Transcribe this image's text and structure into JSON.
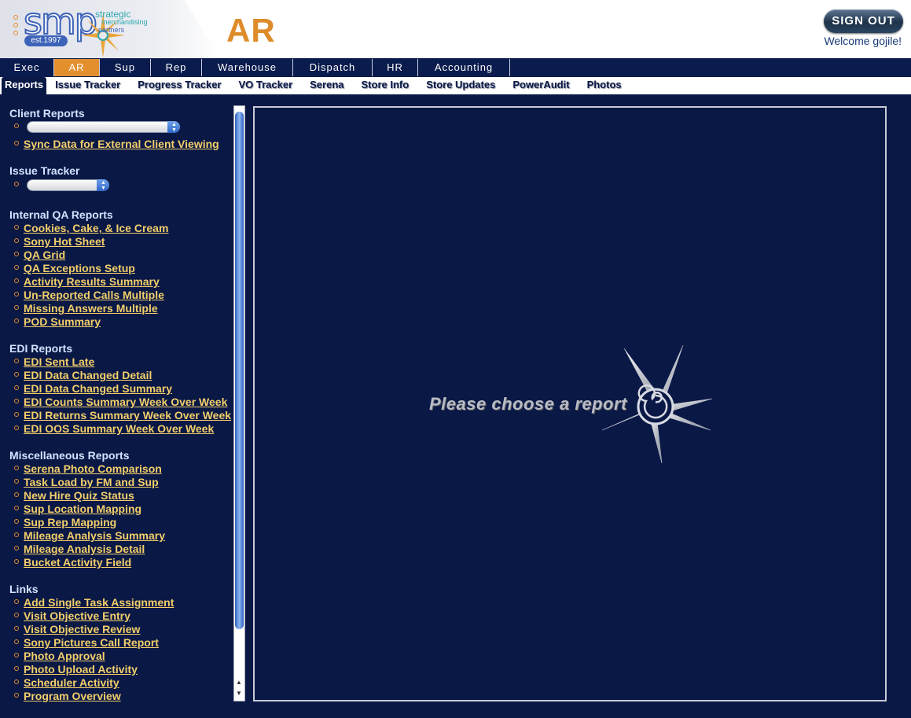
{
  "header": {
    "logo": {
      "mark": "smp",
      "est": "est.1997",
      "line1": "strategic",
      "line2": "merchandising",
      "line3": "partners"
    },
    "page_title": "AR",
    "sign_out_label": "SIGN OUT",
    "welcome": "Welcome gojile!"
  },
  "nav_primary": [
    {
      "label": "Exec",
      "active": false
    },
    {
      "label": "AR",
      "active": true
    },
    {
      "label": "Sup",
      "active": false
    },
    {
      "label": "Rep",
      "active": false
    },
    {
      "label": "Warehouse",
      "active": false
    },
    {
      "label": "Dispatch",
      "active": false
    },
    {
      "label": "HR",
      "active": false
    },
    {
      "label": "Accounting",
      "active": false
    }
  ],
  "nav_secondary": [
    {
      "label": "Reports",
      "active": true
    },
    {
      "label": "Issue Tracker",
      "active": false
    },
    {
      "label": "Progress Tracker",
      "active": false
    },
    {
      "label": "VO Tracker",
      "active": false
    },
    {
      "label": "Serena",
      "active": false
    },
    {
      "label": "Store Info",
      "active": false
    },
    {
      "label": "Store Updates",
      "active": false
    },
    {
      "label": "PowerAudit",
      "active": false
    },
    {
      "label": "Photos",
      "active": false
    }
  ],
  "sidebar": {
    "client_reports": {
      "title": "Client Reports",
      "select_value": "",
      "links": [
        "Sync Data for External Client Viewing"
      ]
    },
    "issue_tracker": {
      "title": "Issue Tracker",
      "select_value": ""
    },
    "internal_qa": {
      "title": "Internal QA Reports",
      "links": [
        "Cookies, Cake, & Ice Cream",
        "Sony Hot Sheet",
        "QA Grid",
        "QA Exceptions Setup",
        "Activity Results Summary",
        "Un-Reported Calls Multiple",
        "Missing Answers Multiple",
        "POD Summary"
      ]
    },
    "edi_reports": {
      "title": "EDI Reports",
      "links": [
        "EDI Sent Late",
        "EDI Data Changed Detail",
        "EDI Data Changed Summary",
        "EDI Counts Summary Week Over Week",
        "EDI Returns Summary Week Over Week",
        "EDI OOS Summary Week Over Week"
      ]
    },
    "misc_reports": {
      "title": "Miscellaneous Reports",
      "links": [
        "Serena Photo Comparison",
        "Task Load by FM and Sup",
        "New Hire Quiz Status",
        "Sup Location Mapping",
        "Sup Rep Mapping",
        "Mileage Analysis Summary",
        "Mileage Analysis Detail",
        "Bucket Activity Field"
      ]
    },
    "links": {
      "title": "Links",
      "links": [
        "Add Single Task Assignment",
        "Visit Objective Entry",
        "Visit Objective Review",
        "Sony Pictures Call Report",
        "Photo Approval",
        "Photo Upload Activity",
        "Scheduler Activity",
        "Program Overview"
      ]
    }
  },
  "main": {
    "prompt": "Please choose a report"
  },
  "colors": {
    "background": "#0a1846",
    "accent": "#e48f2e",
    "link": "#f3cf6a",
    "section_title": "#cfe4ff"
  }
}
